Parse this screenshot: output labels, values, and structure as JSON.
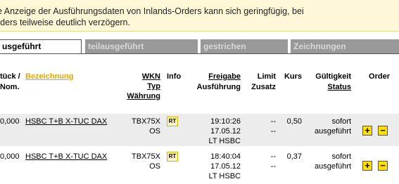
{
  "notice": {
    "line1": "e Anzeige der Ausführungsdaten von Inlands-Orders kann sich geringfügig, bei",
    "line2": "rders teilweise deutlich verzögern."
  },
  "tabs": [
    {
      "label": "usgeführt",
      "active": true
    },
    {
      "label": "teilausgeführt",
      "active": false
    },
    {
      "label": "gestrichen",
      "active": false
    },
    {
      "label": "Zeichnungen",
      "active": false
    }
  ],
  "headers": {
    "stueck": "tück /",
    "nom": "Nom.",
    "bezeichnung": "Bezeichnung",
    "wkn": "WKN",
    "typ": "Typ",
    "waehrung": "Währung",
    "info": "Info",
    "freigabe": "Freigabe",
    "ausfuehrung": "Ausführung",
    "limit": "Limit",
    "zusatz": "Zusatz",
    "kurs": "Kurs",
    "gueltigkeit": "Gültigkeit",
    "status": "Status",
    "order": "Order"
  },
  "rows": [
    {
      "stueck": "0,000",
      "bezeichnung": "HSBC T+B X-TUC DAX",
      "wkn": "TBX75X",
      "typ": "OS",
      "info": "RT",
      "time": "19:10:26",
      "date": "17.05.12",
      "venue": "LT HSBC",
      "limit": "--",
      "zusatz": "--",
      "kurs": "0,50",
      "gueltigkeit": "sofort",
      "status": "ausgeführt",
      "plus": "+",
      "minus": "−"
    },
    {
      "stueck": "0,000",
      "bezeichnung": "HSBC T+B X-TUC DAX",
      "wkn": "TBX75X",
      "typ": "OS",
      "info": "RT",
      "time": "18:40:04",
      "date": "17.05.12",
      "venue": "LT HSBC",
      "limit": "--",
      "zusatz": "--",
      "kurs": "0,37",
      "gueltigkeit": "sofort",
      "status": "ausgeführt",
      "plus": "+",
      "minus": "−"
    }
  ]
}
